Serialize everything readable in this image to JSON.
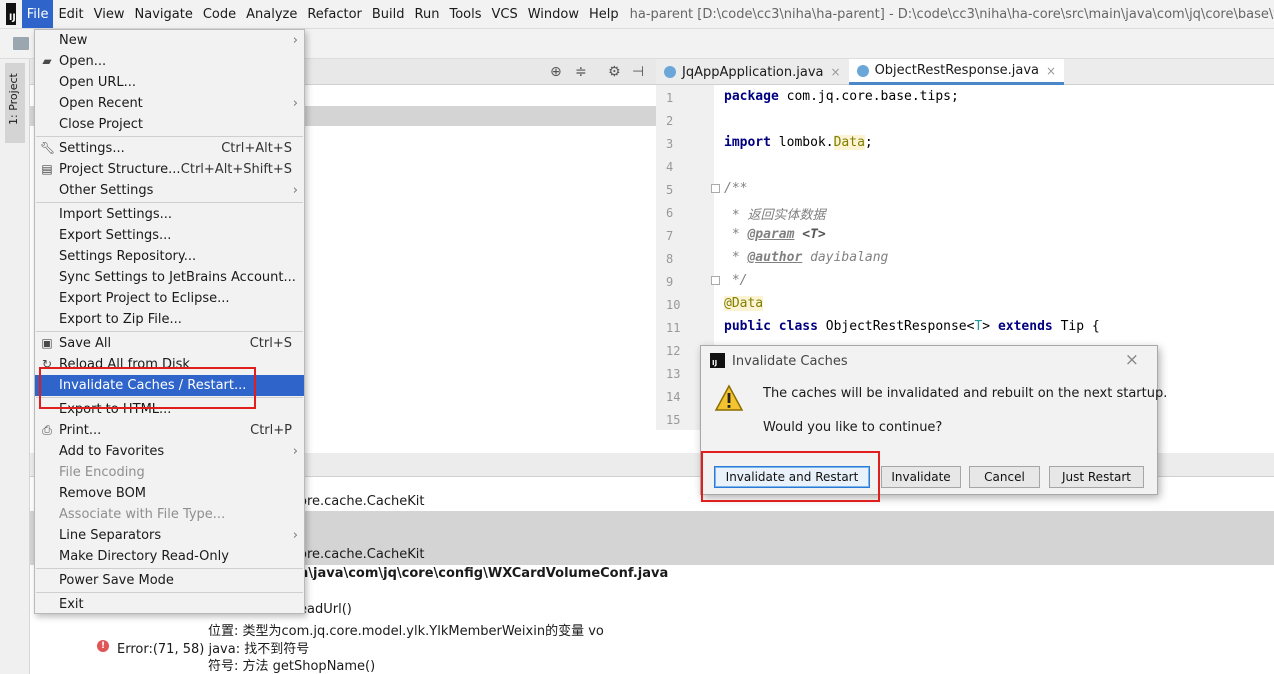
{
  "menubar": {
    "logo": "IJ",
    "items": [
      "File",
      "Edit",
      "View",
      "Navigate",
      "Code",
      "Analyze",
      "Refactor",
      "Build",
      "Run",
      "Tools",
      "VCS",
      "Window",
      "Help"
    ],
    "window_title": "ha-parent [D:\\code\\cc3\\niha\\ha-parent] - D:\\code\\cc3\\niha\\ha-core\\src\\main\\java\\com\\jq\\core\\base\\tips\\ObjectRestR"
  },
  "side_strip": {
    "project_tab": "1: Project"
  },
  "file_menu": {
    "items": [
      {
        "label": "New",
        "arrow": "›"
      },
      {
        "label": "Open...",
        "icon": "folder-open-icon"
      },
      {
        "label": "Open URL..."
      },
      {
        "label": "Open Recent",
        "arrow": "›"
      },
      {
        "label": "Close Project"
      },
      {
        "label": "Settings...",
        "shortcut": "Ctrl+Alt+S",
        "icon": "wrench-icon"
      },
      {
        "label": "Project Structure...",
        "shortcut": "Ctrl+Alt+Shift+S",
        "icon": "project-structure-icon"
      },
      {
        "label": "Other Settings",
        "arrow": "›"
      },
      {
        "label": "Import Settings..."
      },
      {
        "label": "Export Settings..."
      },
      {
        "label": "Settings Repository..."
      },
      {
        "label": "Sync Settings to JetBrains Account..."
      },
      {
        "label": "Export Project to Eclipse..."
      },
      {
        "label": "Export to Zip File..."
      },
      {
        "label": "Save All",
        "shortcut": "Ctrl+S",
        "icon": "save-all-icon"
      },
      {
        "label": "Reload All from Disk",
        "icon": "reload-icon"
      },
      {
        "label": "Invalidate Caches / Restart...",
        "selected": true
      },
      {
        "label": "Export to HTML..."
      },
      {
        "label": "Print...",
        "shortcut": "Ctrl+P",
        "icon": "print-icon"
      },
      {
        "label": "Add to Favorites",
        "arrow": "›"
      },
      {
        "label": "File Encoding",
        "disabled": true
      },
      {
        "label": "Remove BOM"
      },
      {
        "label": "Associate with File Type...",
        "disabled": true
      },
      {
        "label": "Line Separators",
        "arrow": "›"
      },
      {
        "label": "Make Directory Read-Only"
      },
      {
        "label": "Power Save Mode"
      },
      {
        "label": "Exit"
      }
    ]
  },
  "editor": {
    "tabs": [
      {
        "label": "JqAppApplication.java",
        "close": "×"
      },
      {
        "label": "ObjectRestResponse.java",
        "close": "×"
      }
    ],
    "line_numbers": [
      "1",
      "2",
      "3",
      "4",
      "5",
      "6",
      "7",
      "8",
      "9",
      "10",
      "11",
      "12",
      "13",
      "14",
      "15"
    ],
    "code": {
      "l1_kw": "package",
      "l1_rest": " com.jq.core.base.tips;",
      "l3_kw": "import",
      "l3_mid": " lombok.",
      "l3_ann": "Data",
      "l3_end": ";",
      "l5": "/**",
      "l6": " * 返回实体数据",
      "l7_pre": " * ",
      "l7_tag": "@param",
      "l7_post": " <T>",
      "l8_pre": " * ",
      "l8_tag": "@author",
      "l8_post": " dayibalang",
      "l9": " */",
      "l10": "@Data",
      "l11_kw1": "public class",
      "l11_name": " ObjectRestResponse<",
      "l11_gen": "T",
      "l11_mid": "> ",
      "l11_kw2": "extends",
      "l11_end": " Tip {"
    }
  },
  "messages": {
    "line1": "ore.cache.CacheKit",
    "line2": "ore.cache.CacheKit",
    "line3": "n\\java\\com\\jq\\core\\config\\WXCardVolumeConf.java",
    "line4": "eadUrl()",
    "line5": "位置: 类型为com.jq.core.model.ylk.YlkMemberWeixin的变量 vo",
    "line6_err": "Error:(71, 58)  java: 找不到符号",
    "line7": "符号:   方法 getShopName()"
  },
  "dialog": {
    "logo": "IJ",
    "title": "Invalidate Caches",
    "close": "×",
    "message1": "The caches will be invalidated and rebuilt on the next startup.",
    "message2": "Would you like to continue?",
    "buttons": {
      "invalidate_restart": "Invalidate and Restart",
      "invalidate": "Invalidate",
      "cancel": "Cancel",
      "just_restart": "Just Restart"
    }
  },
  "colors": {
    "menu_selection": "#2f65ca",
    "highlight_red": "#e01e1e",
    "default_button_border": "#2b7bd4"
  }
}
